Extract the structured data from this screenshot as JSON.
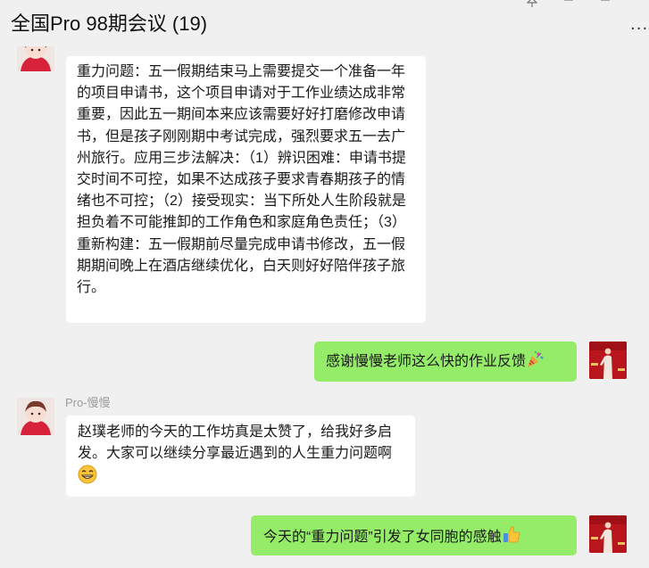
{
  "window": {
    "title": "全国Pro 98期会议 (19)",
    "pin_icon": "pin-icon",
    "minimize_icon": "minimize-icon",
    "maximize_icon": "maximize-icon",
    "more_icon": "more-icon",
    "more_text": "···"
  },
  "messages": [
    {
      "side": "left",
      "sender": "",
      "text": "重力问题：五一假期结束马上需要提交一个准备一年的项目申请书，这个项目申请对于工作业绩达成非常重要，因此五一期间本来应该需要好好打磨修改申请书，但是孩子刚刚期中考试完成，强烈要求五一去广州旅行。应用三步法解决：（1）辨识困难：申请书提交时间不可控，如果不达成孩子要求青春期孩子的情绪也不可控；（2）接受现实：当下所处人生阶段就是担负着不可能推卸的工作角色和家庭角色责任；（3）重新构建：五一假期前尽量完成申请书修改，五一假期期间晚上在酒店继续优化，白天则好好陪伴孩子旅行。"
    },
    {
      "side": "right",
      "text": "感谢慢慢老师这么快的作业反馈",
      "emoji": "party-popper-icon"
    },
    {
      "side": "left",
      "sender": "Pro-慢慢",
      "text": "赵璞老师的今天的工作坊真是太赞了，给我好多启发。大家可以继续分享最近遇到的人生重力问题啊",
      "emoji": "grinning-face-icon"
    },
    {
      "side": "right",
      "text": "今天的“重力问题”引发了女同胞的感触",
      "emoji": "thumbs-up-icon"
    }
  ]
}
